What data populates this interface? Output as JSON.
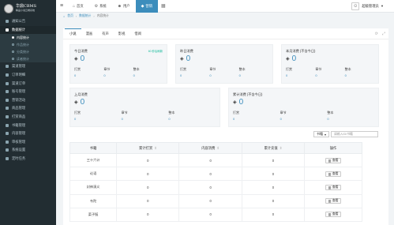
{
  "sidebar": {
    "logo_title": "华鼎CBMS",
    "logo_subtitle": "精品小说云端系统",
    "items_before": [
      {
        "label": "通知公告",
        "icon": "bell-icon"
      }
    ],
    "open_item": {
      "label": "数据统计",
      "icon": "chart-icon"
    },
    "subitems": [
      {
        "label": "内容统计",
        "active": true
      },
      {
        "label": "作品统计",
        "active": false
      },
      {
        "label": "分类统计",
        "active": false
      },
      {
        "label": "读者统计",
        "active": false
      }
    ],
    "items_after": [
      {
        "label": "渠道管理",
        "icon": "channel-icon"
      },
      {
        "label": "订单明细",
        "icon": "order-icon"
      },
      {
        "label": "渠道订单",
        "icon": "orders-icon"
      },
      {
        "label": "账号管理",
        "icon": "account-icon"
      },
      {
        "label": "营销活动",
        "icon": "campaign-icon"
      },
      {
        "label": "商品管理",
        "icon": "goods-icon"
      },
      {
        "label": "打赏商品",
        "icon": "gift-icon"
      },
      {
        "label": "书籍管理",
        "icon": "book-icon"
      },
      {
        "label": "内容管理",
        "icon": "content-icon"
      },
      {
        "label": "审核管理",
        "icon": "audit-icon"
      },
      {
        "label": "系统设置",
        "icon": "settings-icon"
      },
      {
        "label": "定时任务",
        "icon": "clock-icon"
      }
    ]
  },
  "topbar": {
    "nav": [
      {
        "label": "首页",
        "icon": "home-icon",
        "active": false
      },
      {
        "label": "系统",
        "icon": "gear-icon",
        "active": false
      },
      {
        "label": "用户",
        "icon": "user-icon",
        "active": false
      },
      {
        "label": "营销",
        "icon": "campaign-icon",
        "active": true
      }
    ],
    "user_name": "超级管理员"
  },
  "breadcrumb": [
    "首页",
    "数据统计",
    "内容统计"
  ],
  "tabs": [
    {
      "label": "小说",
      "active": true
    },
    {
      "label": "漫画",
      "active": false
    },
    {
      "label": "有声",
      "active": false
    },
    {
      "label": "影视",
      "active": false
    },
    {
      "label": "借阅",
      "active": false
    }
  ],
  "stats": {
    "today": {
      "title": "今日消费",
      "badge": "60 秒后刷新",
      "value": "0",
      "sub": [
        {
          "k": "打赏",
          "v": "0"
        },
        {
          "k": "章节",
          "v": "0"
        },
        {
          "k": "整本",
          "v": "0"
        }
      ]
    },
    "yesterday": {
      "title": "昨日消费",
      "value": "0",
      "sub": [
        {
          "k": "打赏",
          "v": "0"
        },
        {
          "k": "章节",
          "v": "0"
        },
        {
          "k": "整本",
          "v": "0"
        }
      ]
    },
    "this_month": {
      "title": "本月消费 (不含今日)",
      "value": "0",
      "sub": [
        {
          "k": "打赏",
          "v": "0"
        },
        {
          "k": "章节",
          "v": "0"
        },
        {
          "k": "整本",
          "v": "0"
        }
      ]
    },
    "last_month": {
      "title": "上月消费",
      "value": "0",
      "sub": [
        {
          "k": "打赏",
          "v": "0"
        },
        {
          "k": "章节",
          "v": "0"
        },
        {
          "k": "整本",
          "v": "0"
        }
      ]
    },
    "total": {
      "title": "累计消费 (不含今日)",
      "value": "0",
      "sub": [
        {
          "k": "打赏",
          "v": "0"
        },
        {
          "k": "章节",
          "v": "0"
        },
        {
          "k": "整本",
          "v": "0"
        }
      ]
    }
  },
  "search": {
    "select_value": "书籍",
    "placeholder": "请输入ID/书籍"
  },
  "table": {
    "headers": [
      "书籍",
      "累计打赏",
      "内容消费",
      "累计充值",
      "操作"
    ],
    "rows": [
      {
        "name": "三十六计",
        "reward": "0",
        "consume": "0",
        "recharge": "0",
        "action": "查看"
      },
      {
        "name": "论语",
        "reward": "0",
        "consume": "0",
        "recharge": "0",
        "action": "查看"
      },
      {
        "name": "封神演义",
        "reward": "0",
        "consume": "0",
        "recharge": "0",
        "action": "查看"
      },
      {
        "name": "韦陀",
        "reward": "0",
        "consume": "0",
        "recharge": "0",
        "action": "查看"
      },
      {
        "name": "菜子鲢",
        "reward": "0",
        "consume": "0",
        "recharge": "0",
        "action": "查看"
      }
    ]
  },
  "colors": {
    "sidebar_bg": "#222d32",
    "accent": "#3c8dbc",
    "badge_green": "#18bc9c"
  }
}
